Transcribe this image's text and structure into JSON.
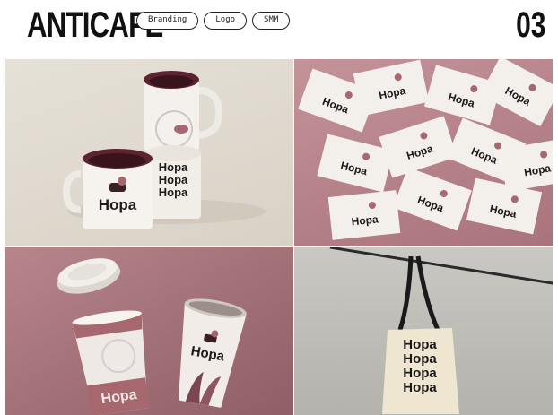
{
  "header": {
    "title": "ANTICAFE",
    "tags": [
      "Branding",
      "Logo",
      "SMM"
    ],
    "counter": "03"
  },
  "gallery": {
    "brand_word": "Hopa",
    "tiles": [
      {
        "subject": "mugs"
      },
      {
        "subject": "business-cards"
      },
      {
        "subject": "paper-cups"
      },
      {
        "subject": "tote-bag"
      }
    ]
  },
  "colors": {
    "accent": "#a7676f",
    "dark": "#1d1a1a",
    "mug_body": "#f4f1ec",
    "card": "#f3f0eb",
    "tote": "#efe6d2"
  }
}
